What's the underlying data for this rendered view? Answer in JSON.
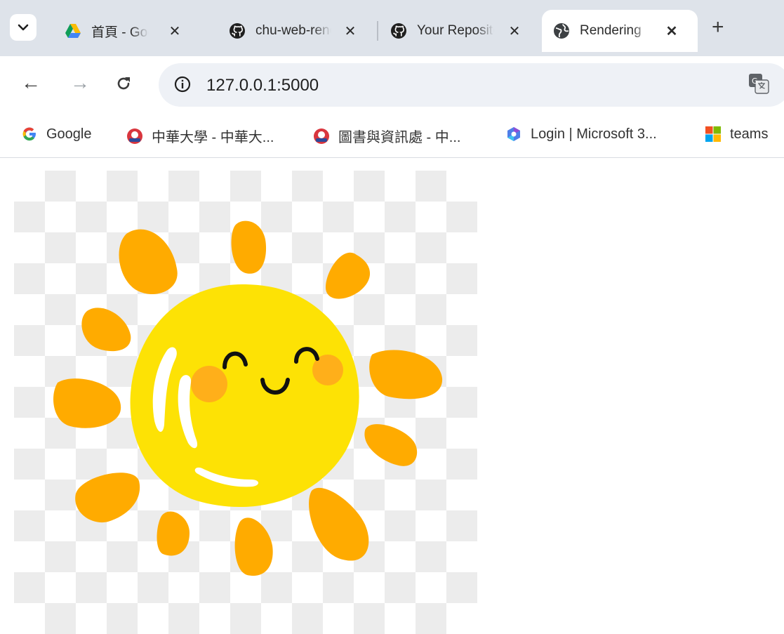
{
  "tabs": [
    {
      "title": "首頁 - Google 雲端硬碟",
      "icon": "google-drive-icon",
      "active": false
    },
    {
      "title": "chu-web-render",
      "icon": "github-icon",
      "active": false
    },
    {
      "title": "Your Repositories",
      "icon": "github-icon",
      "active": false
    },
    {
      "title": "Rendering",
      "icon": "globe-icon",
      "active": true
    }
  ],
  "tab_close_glyph": "✕",
  "new_tab_glyph": "+",
  "toolbar": {
    "back_glyph": "←",
    "forward_glyph": "→",
    "reload_glyph": "C",
    "url": "127.0.0.1:5000"
  },
  "bookmarks": [
    {
      "label": "Google",
      "icon": "google-g-icon"
    },
    {
      "label": "中華大學 - 中華大...",
      "icon": "chu-logo-icon"
    },
    {
      "label": "圖書與資訊處 - 中...",
      "icon": "chu-logo-icon"
    },
    {
      "label": "Login | Microsoft 3...",
      "icon": "microsoft-365-icon"
    },
    {
      "label": "teams",
      "icon": "microsoft-icon"
    }
  ],
  "content": {
    "image": "sun-illustration",
    "colors": {
      "sun_body": "#fde205",
      "rays": "#ffab00",
      "cheeks": "#ffaf1a",
      "checker": "#ececec"
    }
  }
}
